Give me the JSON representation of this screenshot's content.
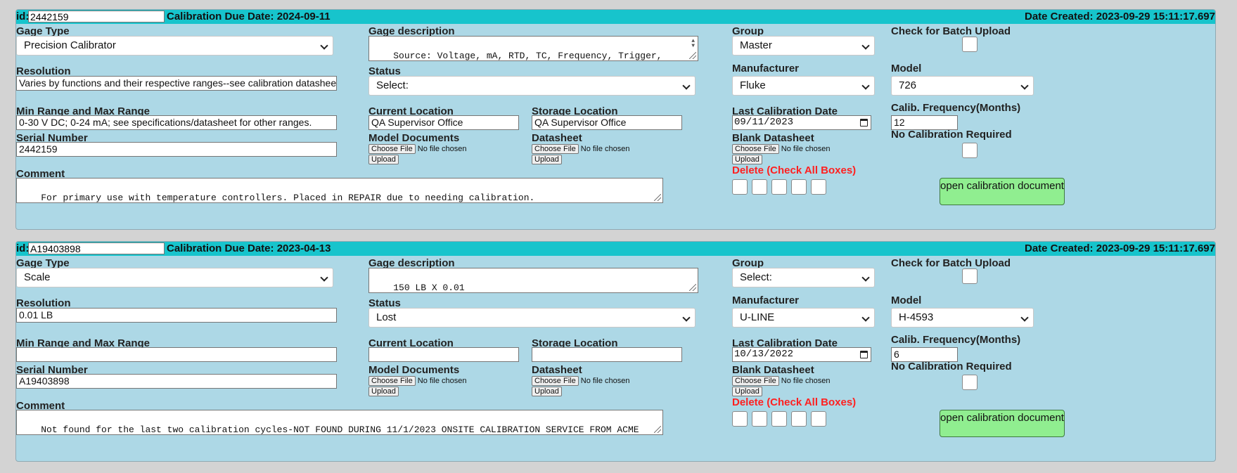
{
  "labels": {
    "id": "id:",
    "cal_due": "Calibration Due Date:",
    "date_created": "Date Created:",
    "gage_type": "Gage Type",
    "gage_description": "Gage description",
    "group": "Group",
    "batch_upload": "Check for Batch Upload",
    "resolution": "Resolution",
    "status": "Status",
    "manufacturer": "Manufacturer",
    "model": "Model",
    "min_max": "Min Range and Max Range",
    "current_location": "Current Location",
    "storage_location": "Storage Location",
    "last_cal_date": "Last Calibration Date",
    "cal_freq": "Calib. Frequency(Months)",
    "serial": "Serial Number",
    "model_docs": "Model Documents",
    "datasheet": "Datasheet",
    "blank_datasheet": "Blank Datasheet",
    "no_cal": "No Calibration Required",
    "comment": "Comment",
    "delete": "Delete (Check All Boxes)",
    "choose_file": "Choose File",
    "no_file": "No file chosen",
    "upload": "Upload",
    "open_cal": "open calibration document"
  },
  "records": [
    {
      "id": "2442159",
      "cal_due_date": "2024-09-11",
      "date_created": "2023-09-29 15:11:17.697",
      "gage_type": "Precision Calibrator",
      "gage_description": "Source: Voltage, mA, RTD, TC, Frequency, Trigger, Pulse, Loop Power. Measure: Voltage, mA, TC, RTD, Freq.",
      "group": "Master",
      "resolution": "Varies by functions and their respective ranges--see calibration datasheet (W",
      "status": "Select:",
      "manufacturer": "Fluke",
      "model": "726",
      "min_max": "0-30 V DC; 0-24 mA; see specifications/datasheet for other ranges.",
      "current_location": "QA Supervisor Office",
      "storage_location": "QA Supervisor Office",
      "last_cal_date": "09/11/2023",
      "cal_freq": "12",
      "serial": "2442159",
      "comment": "For primary use with temperature controllers. Placed in REPAIR due to needing calibration."
    },
    {
      "id": "A19403898",
      "cal_due_date": "2023-04-13",
      "date_created": "2023-09-29 15:11:17.697",
      "gage_type": "Scale",
      "gage_description": "150 LB X 0.01",
      "group": "Select:",
      "resolution": "0.01 LB",
      "status": "Lost",
      "manufacturer": "U-LINE",
      "model": "H-4593",
      "min_max": "",
      "current_location": "",
      "storage_location": "",
      "last_cal_date": "10/13/2022",
      "cal_freq": "6",
      "serial": "A19403898",
      "comment": "Not found for the last two calibration cycles-NOT FOUND DURING 11/1/2023 ONSITE CALIBRATION SERVICE FROM ACME METROLOGY."
    }
  ]
}
